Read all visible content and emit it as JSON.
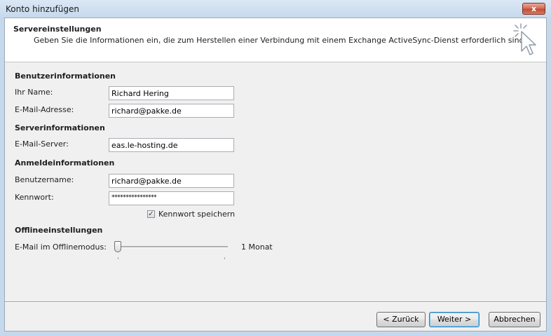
{
  "window": {
    "title": "Konto hinzufügen",
    "close_label": "x"
  },
  "header": {
    "title": "Servereinstellungen",
    "description": "Geben Sie die Informationen ein, die zum Herstellen einer Verbindung mit einem Exchange ActiveSync-Dienst erforderlich sind."
  },
  "sections": {
    "user": "Benutzerinformationen",
    "server": "Serverinformationen",
    "login": "Anmeldeinformationen",
    "offline": "Offlineeinstellungen"
  },
  "fields": {
    "name": {
      "label": "Ihr Name:",
      "value": "Richard Hering"
    },
    "email": {
      "label": "E-Mail-Adresse:",
      "value": "richard@pakke.de"
    },
    "server": {
      "label": "E-Mail-Server:",
      "value": "eas.le-hosting.de"
    },
    "username": {
      "label": "Benutzername:",
      "value": "richard@pakke.de"
    },
    "password": {
      "label": "Kennwort:",
      "value": "****************"
    }
  },
  "remember_password": {
    "label": "Kennwort speichern",
    "checked": true
  },
  "offline_mode": {
    "label": "E-Mail im Offlinemodus:",
    "value": "1 Monat"
  },
  "buttons": {
    "back": "< Zurück",
    "next": "Weiter >",
    "cancel": "Abbrechen"
  }
}
